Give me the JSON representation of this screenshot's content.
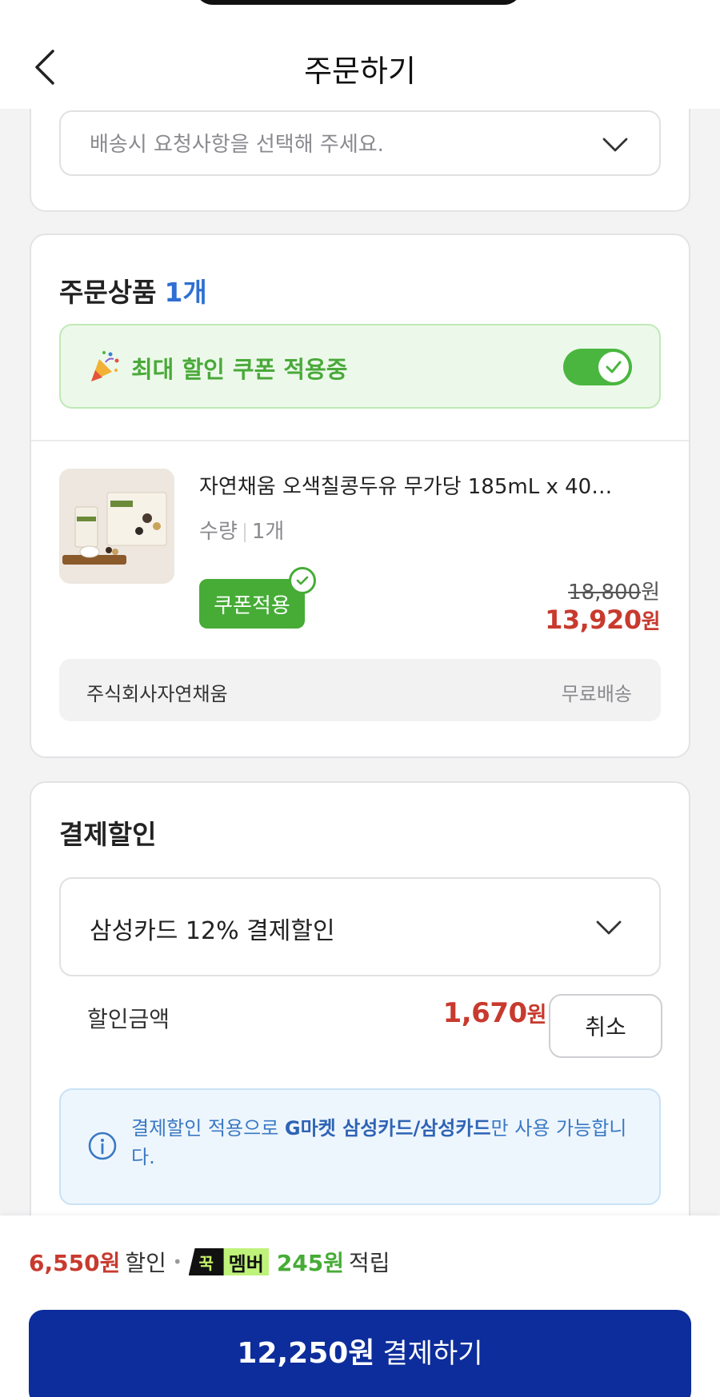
{
  "header": {
    "title": "주문하기"
  },
  "delivery": {
    "request_placeholder": "배송시 요청사항을 선택해 주세요."
  },
  "order": {
    "section_title": "주문상품",
    "count": "1개",
    "coupon_banner": "최대 할인 쿠폰 적용중",
    "coupon_toggle_on": true,
    "product": {
      "name": "자연채움 오색칠콩두유 무가당 185mL x 40…",
      "qty_label": "수량",
      "qty_value": "1개",
      "coupon_badge": "쿠폰적용",
      "original_price": "18,800",
      "original_unit": "원",
      "sale_price": "13,920",
      "sale_unit": "원"
    },
    "seller": "주식회사자연채움",
    "shipping": "무료배송"
  },
  "payment_discount": {
    "section_title": "결제할인",
    "selected": "삼성카드 12% 결제할인",
    "amount_label": "할인금액",
    "amount": "1,670",
    "amount_unit": "원",
    "cancel_label": "취소",
    "info_pre": "결제할인 적용으로 ",
    "info_bold": "G마켓 삼성카드/삼성카드",
    "info_post": "만 사용 가능합니다."
  },
  "footer": {
    "discount_amount": "6,550원",
    "discount_label": "할인",
    "member_badge_left": "꾹",
    "member_badge_right": "멤버",
    "points": "245원",
    "points_label": "적립",
    "pay_amount": "12,250원",
    "pay_label": "결제하기"
  },
  "colors": {
    "accent_blue": "#0d2d9c",
    "price_red": "#c83a2e",
    "coupon_green": "#46ac36"
  }
}
